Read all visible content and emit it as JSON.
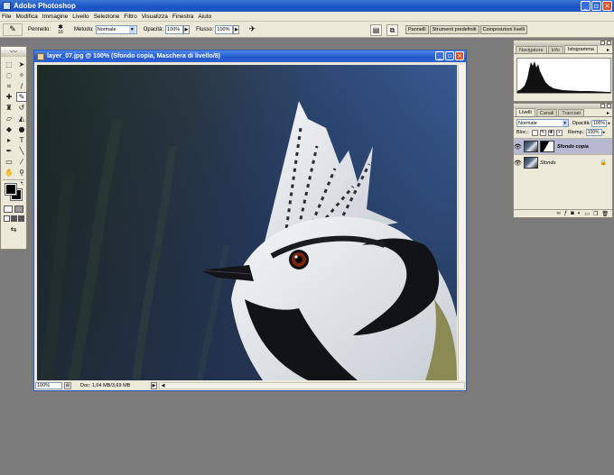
{
  "app": {
    "title": "Adobe Photoshop"
  },
  "window_buttons": {
    "minimize": "_",
    "maximize": "▫",
    "close": "×"
  },
  "menu": [
    "File",
    "Modifica",
    "Immagine",
    "Livello",
    "Selezione",
    "Filtro",
    "Visualizza",
    "Finestra",
    "Aiuto"
  ],
  "options": {
    "brush_label": "Pennello:",
    "brush_size": "16",
    "mode_label": "Metodo:",
    "mode_value": "Normale",
    "opacity_label": "Opacità:",
    "opacity_value": "100%",
    "flow_label": "Flusso:",
    "flow_value": "100%"
  },
  "palette_well": [
    "Pannelli",
    "Strumenti predefiniti",
    "Composizioni livelli"
  ],
  "document": {
    "title": "layer_07.jpg @ 100% (Sfondo copia, Maschera di livello/8)",
    "zoom": "100%",
    "doc_info": "Doc: 1,64 MB/3,69 MB"
  },
  "histogram_panel": {
    "tabs": [
      "Navigatore",
      "Info",
      "Istogramma"
    ],
    "active_tab": "Istogramma"
  },
  "layers_panel": {
    "tabs": [
      "Livelli",
      "Canali",
      "Tracciati"
    ],
    "active_tab": "Livelli",
    "blend_mode": "Normale",
    "opacity_label": "Opacità:",
    "opacity_value": "100%",
    "lock_label": "Bloc.:",
    "fill_label": "Riemp.:",
    "fill_value": "100%",
    "layers": [
      {
        "name": "Sfondo copia",
        "active": true,
        "has_mask": true,
        "locked": false
      },
      {
        "name": "Sfondo",
        "active": false,
        "has_mask": false,
        "locked": true
      }
    ]
  },
  "colors": {
    "titlebar": "#2058c8",
    "chrome": "#ece9d8",
    "workspace": "#7b7b7b",
    "close_button": "#d9532e",
    "active_layer": "#b8b8d0"
  }
}
